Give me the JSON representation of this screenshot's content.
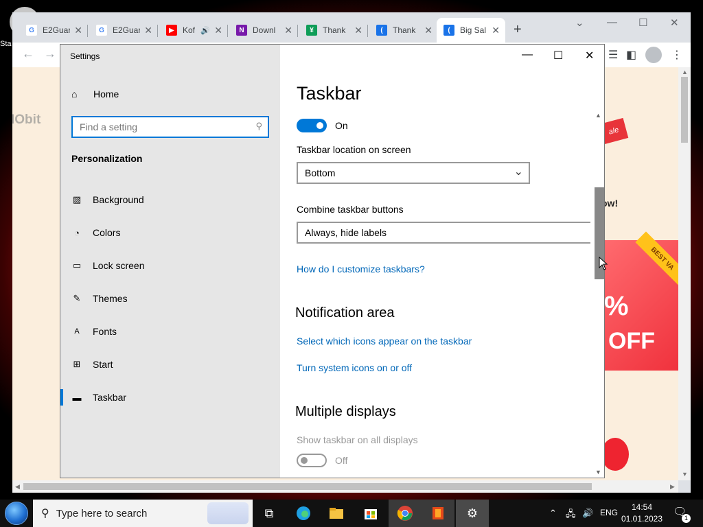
{
  "desktop": {
    "label": "Sta"
  },
  "chrome": {
    "tabs": [
      {
        "title": "E2Guar",
        "favicon": "google-icon",
        "color": "#4285f4"
      },
      {
        "title": "E2Guar",
        "favicon": "google-icon",
        "color": "#4285f4"
      },
      {
        "title": "Kof",
        "favicon": "youtube-icon",
        "color": "#ff0000"
      },
      {
        "title": "Downl",
        "favicon": "onenote-icon",
        "color": "#7719aa"
      },
      {
        "title": "Thank",
        "favicon": "sheet-icon",
        "color": "#0f9d58"
      },
      {
        "title": "Thank",
        "favicon": "shield-icon",
        "color": "#1a73e8"
      },
      {
        "title": "Big Sal",
        "favicon": "shield-icon",
        "color": "#1a73e8"
      }
    ],
    "new_tab": "+",
    "page": {
      "brand": "IObit",
      "sale_tag": "ale",
      "promo_text": "ow!",
      "ribbon": "BEST VA",
      "percent": "%",
      "off": "OFF"
    }
  },
  "settings": {
    "window_title": "Settings",
    "home": "Home",
    "search_placeholder": "Find a setting",
    "section": "Personalization",
    "nav_items": [
      {
        "label": "Background",
        "icon": "image-icon"
      },
      {
        "label": "Colors",
        "icon": "palette-icon"
      },
      {
        "label": "Lock screen",
        "icon": "lock-screen-icon"
      },
      {
        "label": "Themes",
        "icon": "brush-icon"
      },
      {
        "label": "Fonts",
        "icon": "font-icon"
      },
      {
        "label": "Start",
        "icon": "start-icon"
      },
      {
        "label": "Taskbar",
        "icon": "taskbar-icon",
        "selected": true
      }
    ],
    "page_title": "Taskbar",
    "toggle_top": {
      "state": "On"
    },
    "location_label": "Taskbar location on screen",
    "location_value": "Bottom",
    "combine_label": "Combine taskbar buttons",
    "combine_value": "Always, hide labels",
    "help_link": "How do I customize taskbars?",
    "notification_heading": "Notification area",
    "notif_link_1": "Select which icons appear on the taskbar",
    "notif_link_2": "Turn system icons on or off",
    "multiple_heading": "Multiple displays",
    "show_all_label": "Show taskbar on all displays",
    "toggle_bottom": {
      "state": "Off"
    }
  },
  "taskbar": {
    "search_placeholder": "Type here to search",
    "language": "ENG",
    "time": "14:54",
    "date": "01.01.2023",
    "notification_count": "1"
  }
}
